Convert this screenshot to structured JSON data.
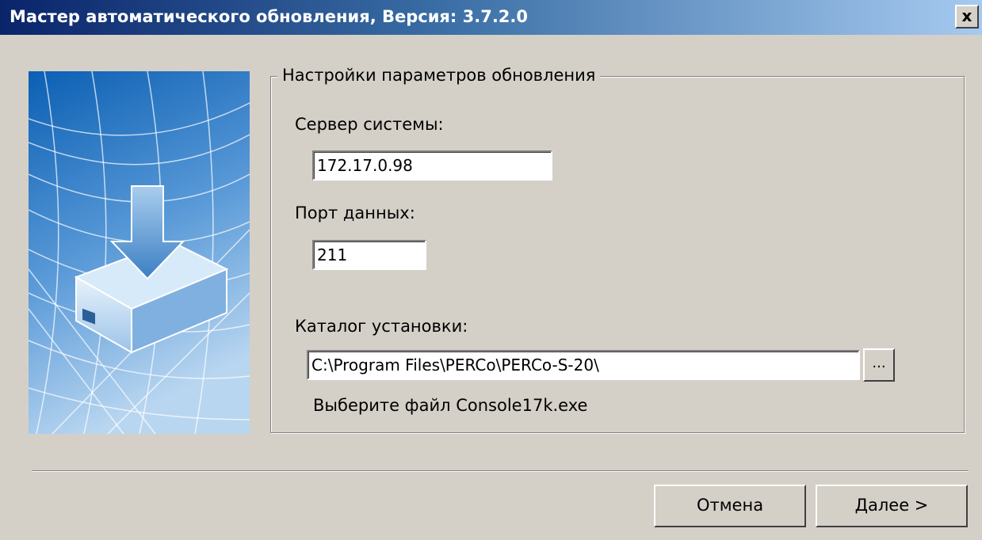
{
  "window": {
    "title": "Мастер автоматического обновления, Версия: 3.7.2.0",
    "close_label": "x"
  },
  "banner": {
    "image": "download-box-illustration",
    "colors": {
      "top": "#0b5fb3",
      "bottom": "#b9d6f0"
    }
  },
  "settings": {
    "group_title": "Настройки параметров обновления",
    "server_label": "Сервер системы:",
    "server_value": "172.17.0.98",
    "port_label": "Порт данных:",
    "port_value": "211",
    "install_dir_label": "Каталог установки:",
    "install_dir_value": "C:\\Program Files\\PERCo\\PERCo-S-20\\",
    "browse_label": "...",
    "hint": "Выберите файл Console17k.exe"
  },
  "buttons": {
    "cancel": "Отмена",
    "next": "Далее >"
  }
}
